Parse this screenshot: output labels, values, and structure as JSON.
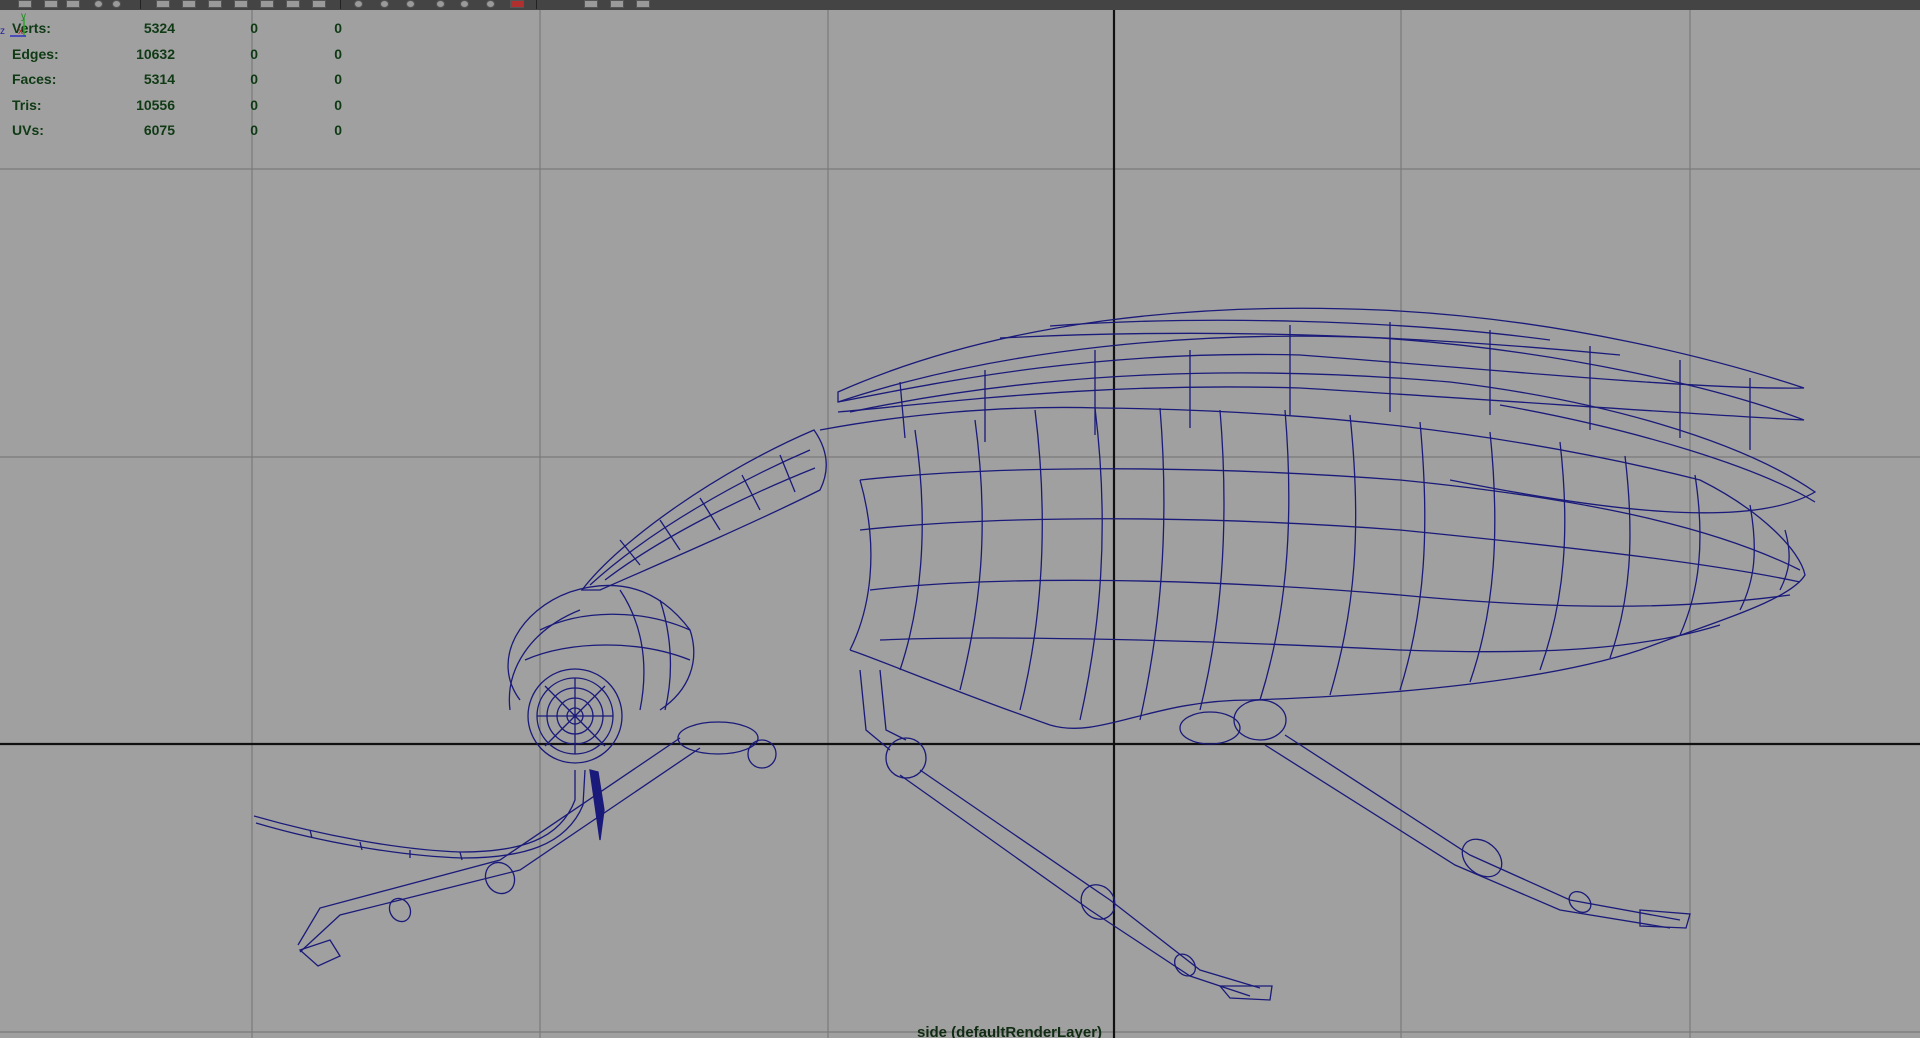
{
  "toolbar": {
    "icons": [
      "toolbar-icon-1",
      "toolbar-icon-2",
      "toolbar-icon-3",
      "toolbar-icon-4",
      "toolbar-icon-5",
      "toolbar-icon-6",
      "toolbar-icon-7",
      "toolbar-icon-8",
      "toolbar-icon-9",
      "toolbar-icon-10",
      "toolbar-icon-11",
      "toolbar-icon-12",
      "toolbar-icon-13",
      "toolbar-icon-14",
      "toolbar-icon-15",
      "toolbar-icon-16",
      "toolbar-icon-17",
      "toolbar-icon-18"
    ]
  },
  "hud": {
    "rows": [
      {
        "label": "Verts:",
        "v1": "5324",
        "v2": "0",
        "v3": "0"
      },
      {
        "label": "Edges:",
        "v1": "10632",
        "v2": "0",
        "v3": "0"
      },
      {
        "label": "Faces:",
        "v1": "5314",
        "v2": "0",
        "v3": "0"
      },
      {
        "label": "Tris:",
        "v1": "10556",
        "v2": "0",
        "v3": "0"
      },
      {
        "label": "UVs:",
        "v1": "6075",
        "v2": "0",
        "v3": "0"
      }
    ]
  },
  "viewport": {
    "camera_label": "side (defaultRenderLayer)",
    "axis_y": "y",
    "axis_z": "z",
    "axis_x": "x",
    "wire_color": "#1a1a7a",
    "grid_color": "#7a7a7a",
    "axis_line_color": "#111111",
    "background": "#a0a0a0"
  }
}
